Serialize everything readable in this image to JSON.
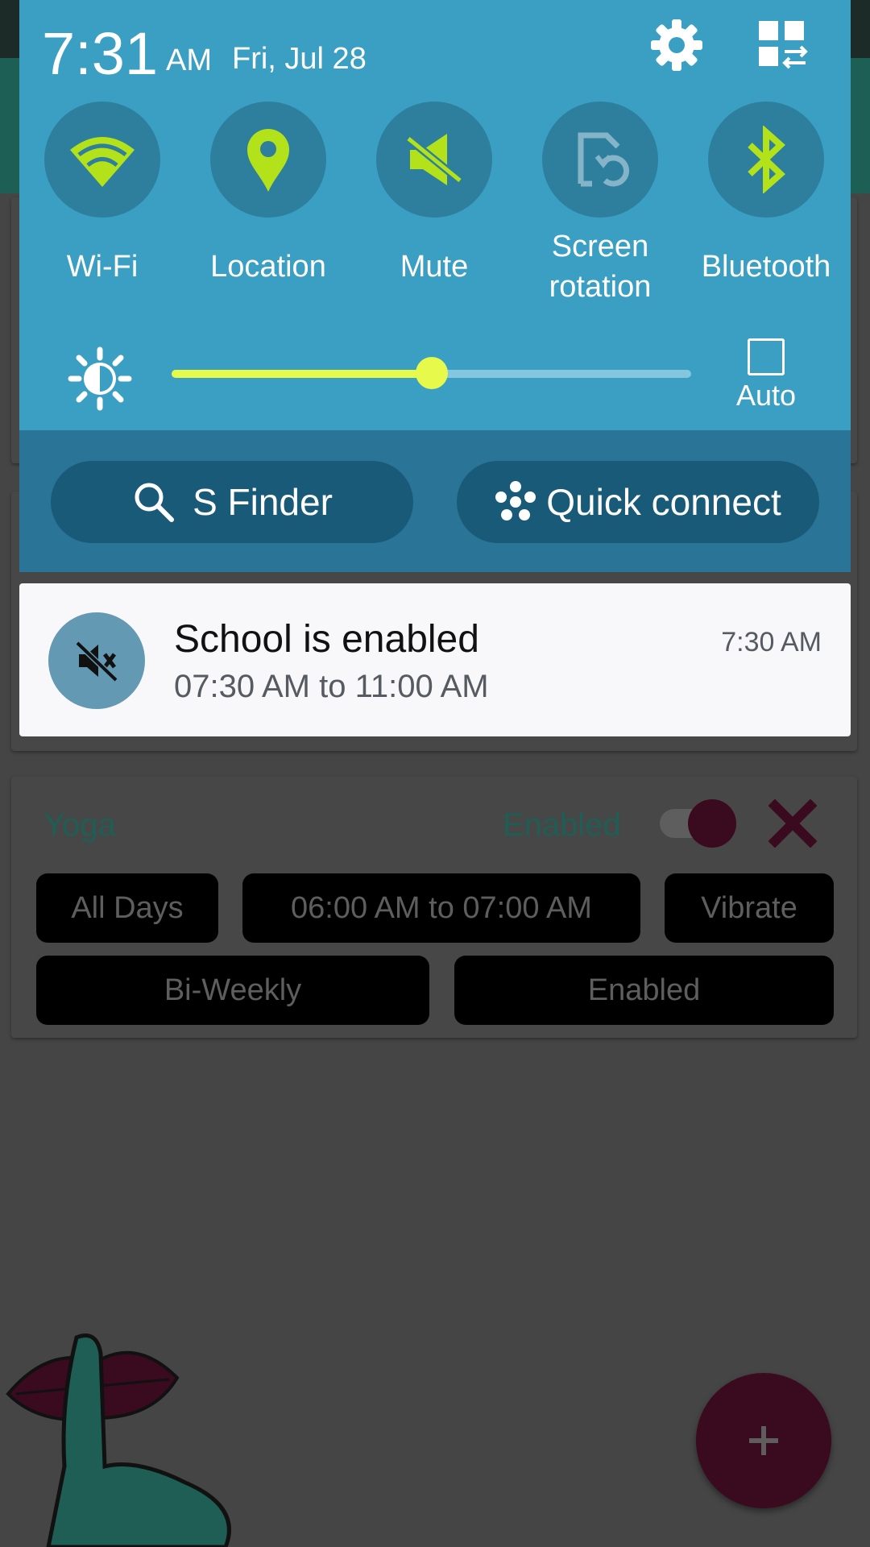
{
  "status_bar": {
    "time": "7:31",
    "ampm": "AM",
    "date": "Fri, Jul 28"
  },
  "header_icons": [
    "gear-icon",
    "grid-edit-icon"
  ],
  "quick_settings": {
    "tiles": [
      {
        "label": "Wi-Fi",
        "icon": "wifi-icon",
        "active": true
      },
      {
        "label": "Location",
        "icon": "location-pin-icon",
        "active": true
      },
      {
        "label": "Mute",
        "icon": "mute-icon",
        "active": true
      },
      {
        "label": "Screen\nrotation",
        "icon": "screen-rotation-icon",
        "active": false
      },
      {
        "label": "Bluetooth",
        "icon": "bluetooth-icon",
        "active": true
      }
    ],
    "brightness_percent": 50,
    "auto_label": "Auto",
    "accent_color": "#e7f94b"
  },
  "actions": {
    "s_finder": "S Finder",
    "quick_connect": "Quick connect"
  },
  "notification": {
    "title": "School is enabled",
    "body": "07:30 AM to 11:00 AM",
    "time": "7:30 AM",
    "icon": "speaker-muted-icon"
  },
  "profile_card": {
    "name": "Yoga",
    "status": "Enabled",
    "days": "All Days",
    "time_range": "06:00 AM to 07:00 AM",
    "mode": "Vibrate",
    "repeat": "Bi-Weekly",
    "state": "Enabled"
  }
}
